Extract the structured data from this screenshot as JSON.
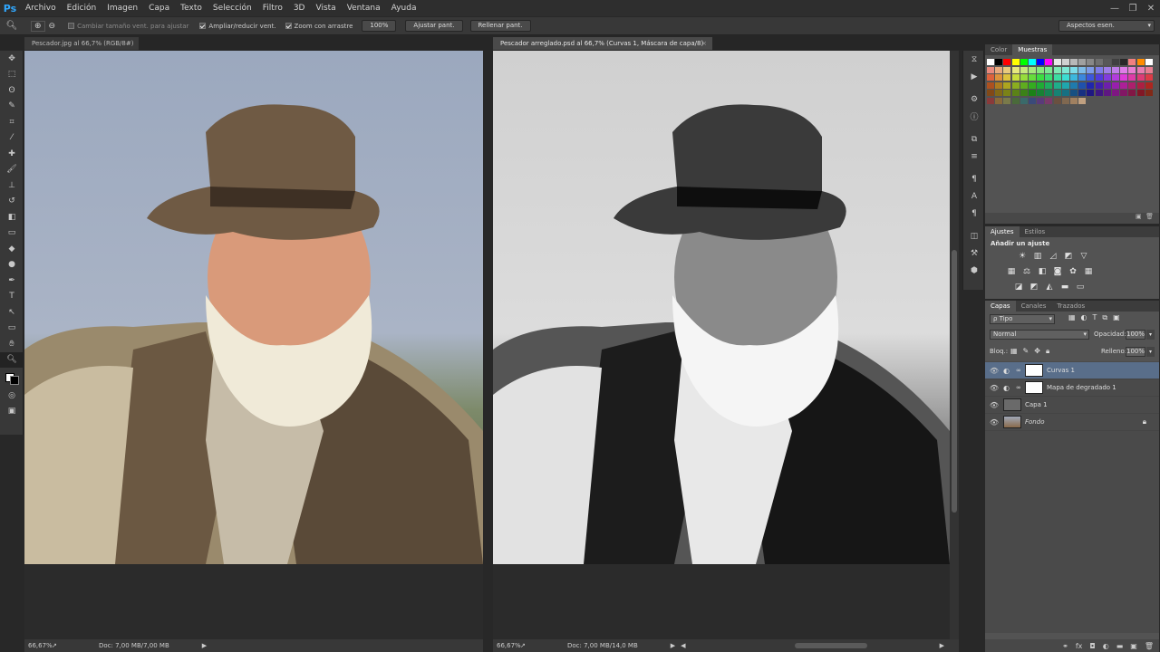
{
  "app": {
    "logo": "Ps"
  },
  "menu": [
    "Archivo",
    "Edición",
    "Imagen",
    "Capa",
    "Texto",
    "Selección",
    "Filtro",
    "3D",
    "Vista",
    "Ventana",
    "Ayuda"
  ],
  "window_controls": {
    "minimize": "—",
    "restore": "❐",
    "close": "✕"
  },
  "options_bar": {
    "tool_icon": "zoom-icon",
    "resize_windows": {
      "label": "Cambiar tamaño vent. para ajustar",
      "checked": false
    },
    "zoom_all": {
      "label": "Ampliar/reducir vent.",
      "checked": true
    },
    "scrubby_zoom": {
      "label": "Zoom con arrastre",
      "checked": true
    },
    "zoom_level_btn": "100%",
    "fit_screen_btn": "Ajustar pant.",
    "fill_screen_btn": "Rellenar pant.",
    "workspace": "Aspectos esen."
  },
  "docs": [
    {
      "title": "Pescador.jpg al 66,7% (RGB/8#)",
      "zoom": "66,67%",
      "doc_size": "Doc: 7,00 MB/7,00 MB"
    },
    {
      "title": "Pescador arreglado.psd al 66,7% (Curvas 1, Máscara de capa/8)",
      "zoom": "66,67%",
      "doc_size": "Doc: 7,00 MB/14,0 MB"
    }
  ],
  "close_glyph": "×",
  "color_panel": {
    "tabs": [
      "Color",
      "Muestras"
    ],
    "active": "Muestras"
  },
  "adjust_panel": {
    "tabs": [
      "Ajustes",
      "Estilos"
    ],
    "active": "Ajustes",
    "heading": "Añadir un ajuste"
  },
  "layers_panel": {
    "tabs": [
      "Capas",
      "Canales",
      "Trazados"
    ],
    "active": "Capas",
    "filter": "ρ Tipo",
    "blend_mode": "Normal",
    "opacity_label": "Opacidad:",
    "opacity": "100%",
    "lock_label": "Bloq.:",
    "fill_label": "Relleno:",
    "fill": "100%",
    "layers": [
      {
        "name": "Curvas 1",
        "selected": true
      },
      {
        "name": "Mapa de degradado 1",
        "selected": false
      },
      {
        "name": "Capa 1",
        "selected": false
      },
      {
        "name": "Fondo",
        "selected": false
      }
    ],
    "footer_icons": [
      "link-icon",
      "fx-icon",
      "mask-icon",
      "adjustment-icon",
      "folder-icon",
      "new-layer-icon",
      "trash-icon"
    ]
  },
  "colors": {
    "accent": "#31a8ff",
    "selected_layer": "#596e8a",
    "panel": "#535353",
    "sky": "#a8b4c8"
  }
}
